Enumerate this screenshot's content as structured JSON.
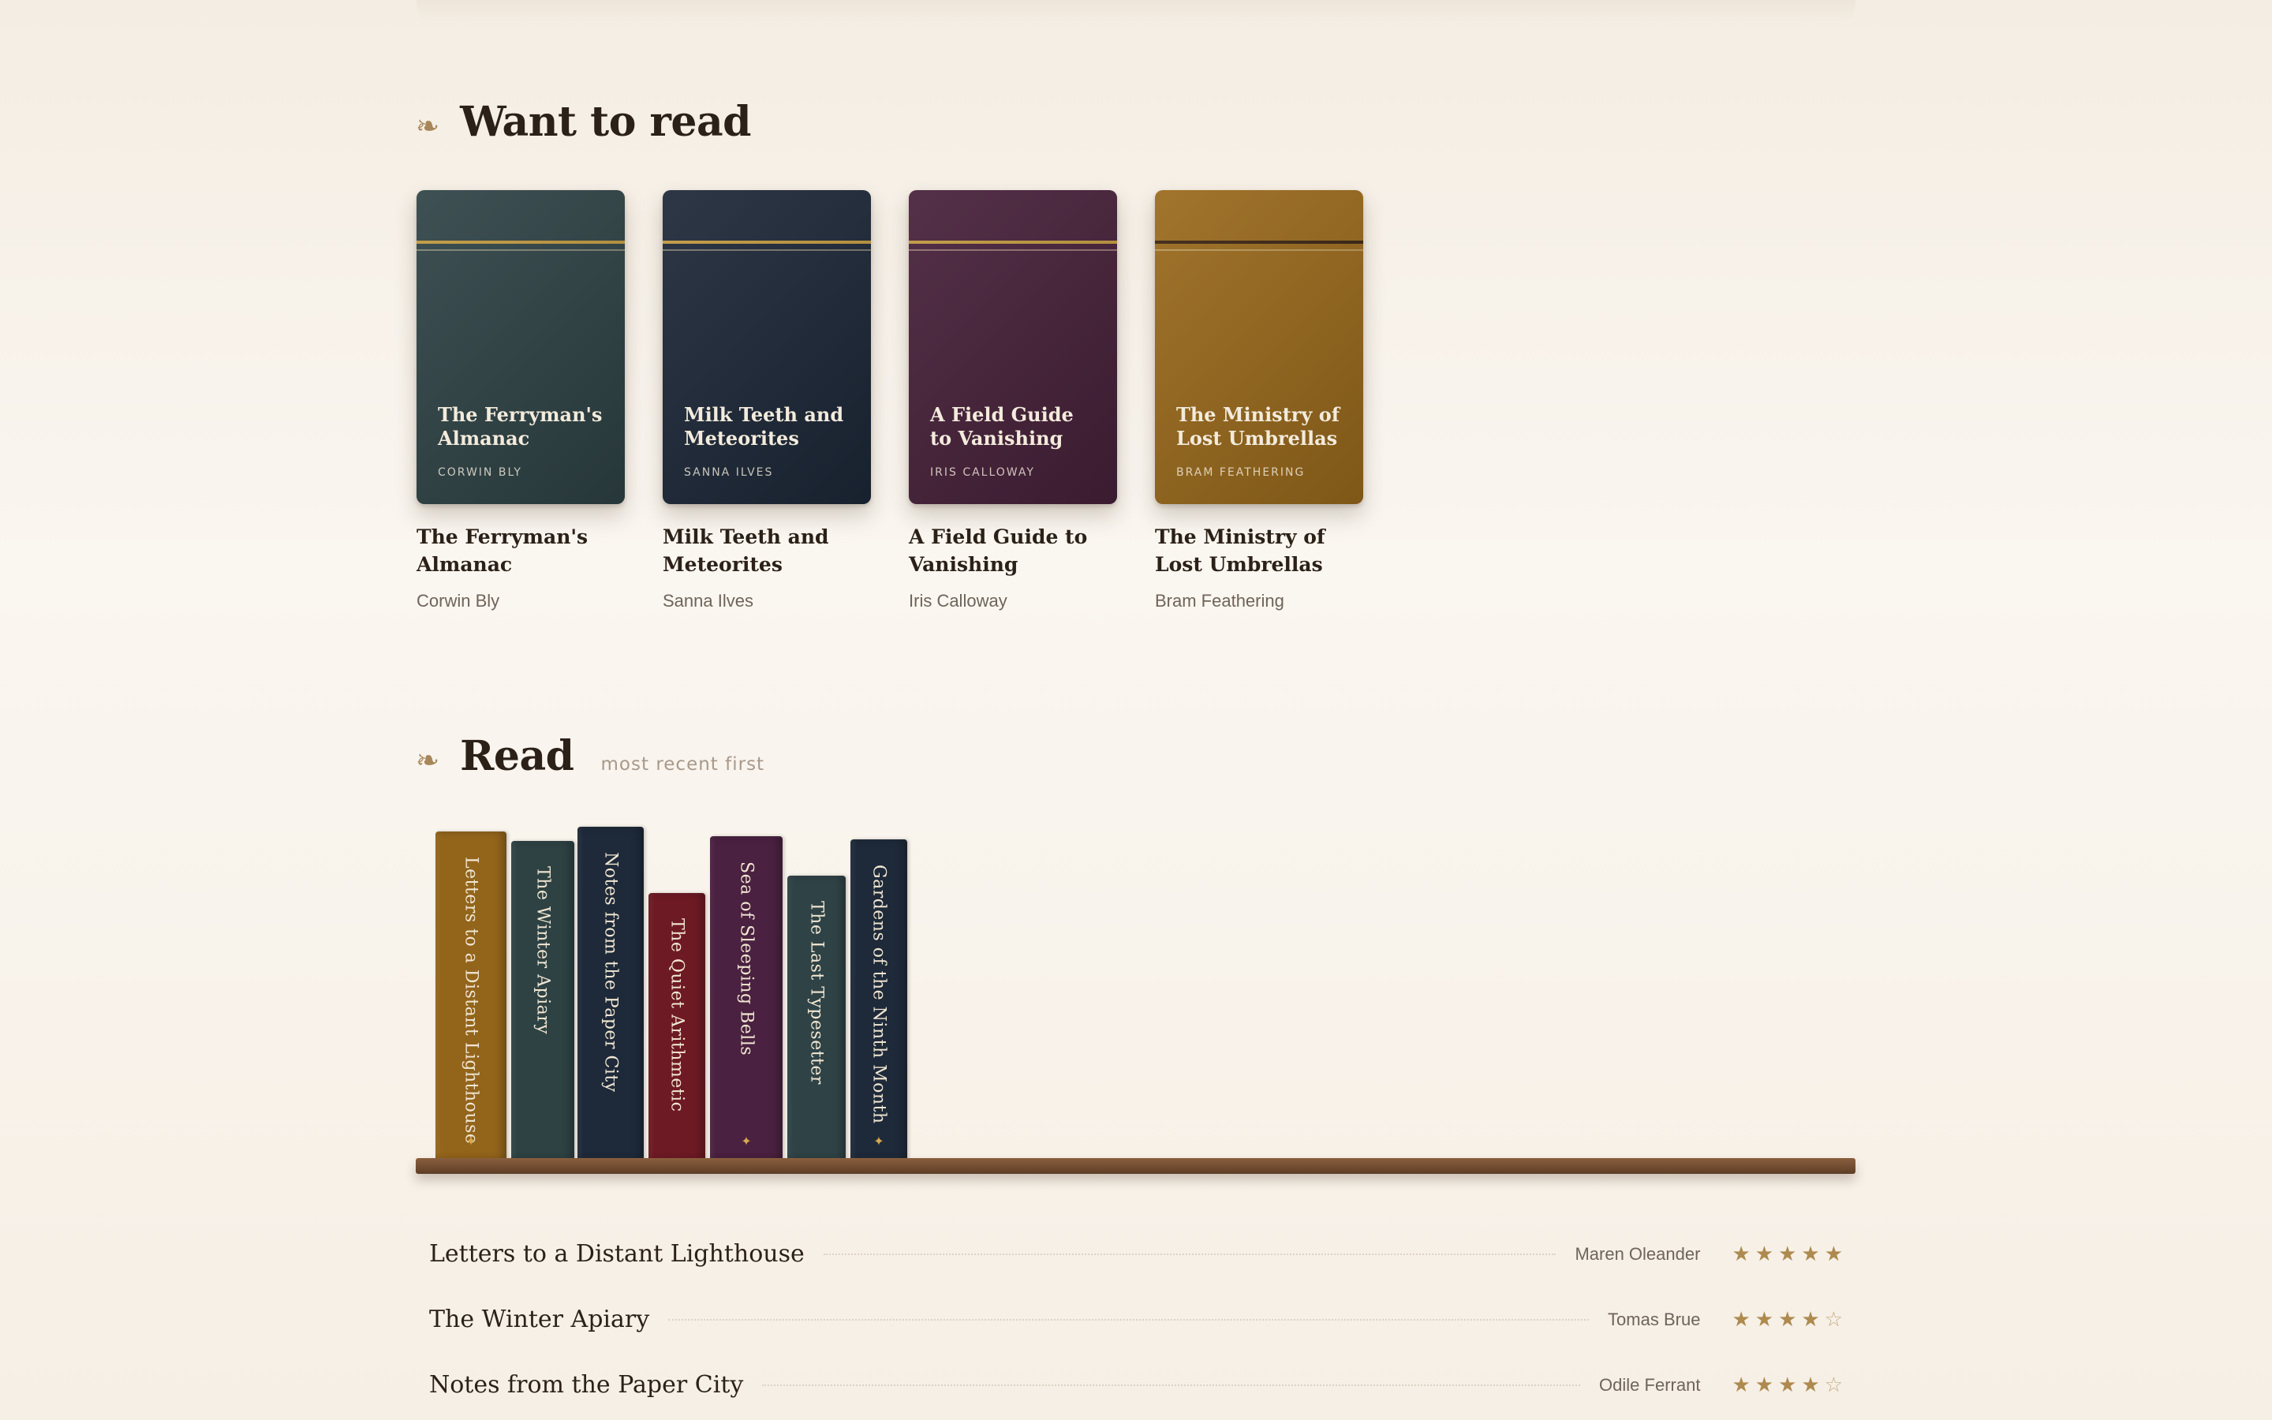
{
  "sections": {
    "want": {
      "title": "Want to read",
      "fleuron": "❧"
    },
    "read": {
      "title": "Read",
      "subtitle": "most recent first",
      "fleuron": "❧"
    }
  },
  "want_to_read": [
    {
      "title": "The Ferryman's Almanac",
      "author": "Corwin Bly",
      "cover_author": "CORWIN BLY",
      "color": "#2f4346",
      "rule": "#c29a3f"
    },
    {
      "title": "Milk Teeth and Meteorites",
      "author": "Sanna Ilves",
      "cover_author": "SANNA ILVES",
      "color": "#1d2838",
      "rule": "#c29a3f"
    },
    {
      "title": "A Field Guide to Vanishing",
      "author": "Iris Calloway",
      "cover_author": "IRIS CALLOWAY",
      "color": "#47213a",
      "rule": "#c29a3f"
    },
    {
      "title": "The Ministry of Lost Umbrellas",
      "author": "Bram Feathering",
      "cover_author": "BRAM FEATHERING",
      "color": "#9a6a1c",
      "rule": "#3a2412"
    }
  ],
  "shelf": [
    {
      "title": "Letters to a Distant Lighthouse",
      "color": "#93651b",
      "mark": "✦"
    },
    {
      "title": "The Winter Apiary",
      "color": "#2e4244",
      "mark": ""
    },
    {
      "title": "Notes from the Paper City",
      "color": "#1e2a3a",
      "mark": ""
    },
    {
      "title": "The Quiet Arithmetic",
      "color": "#6e1a24",
      "mark": ""
    },
    {
      "title": "Sea of Sleeping Bells",
      "color": "#4a2140",
      "mark": "✦"
    },
    {
      "title": "The Last Typesetter",
      "color": "#2f4346",
      "mark": ""
    },
    {
      "title": "Gardens of the Ninth Month",
      "color": "#1e2a3a",
      "mark": "✦"
    }
  ],
  "read_list": [
    {
      "title": "Letters to a Distant Lighthouse",
      "author": "Maren Oleander",
      "rating": 5
    },
    {
      "title": "The Winter Apiary",
      "author": "Tomas Brue",
      "rating": 4
    },
    {
      "title": "Notes from the Paper City",
      "author": "Odile Ferrant",
      "rating": 4
    }
  ],
  "rating_max": 5
}
